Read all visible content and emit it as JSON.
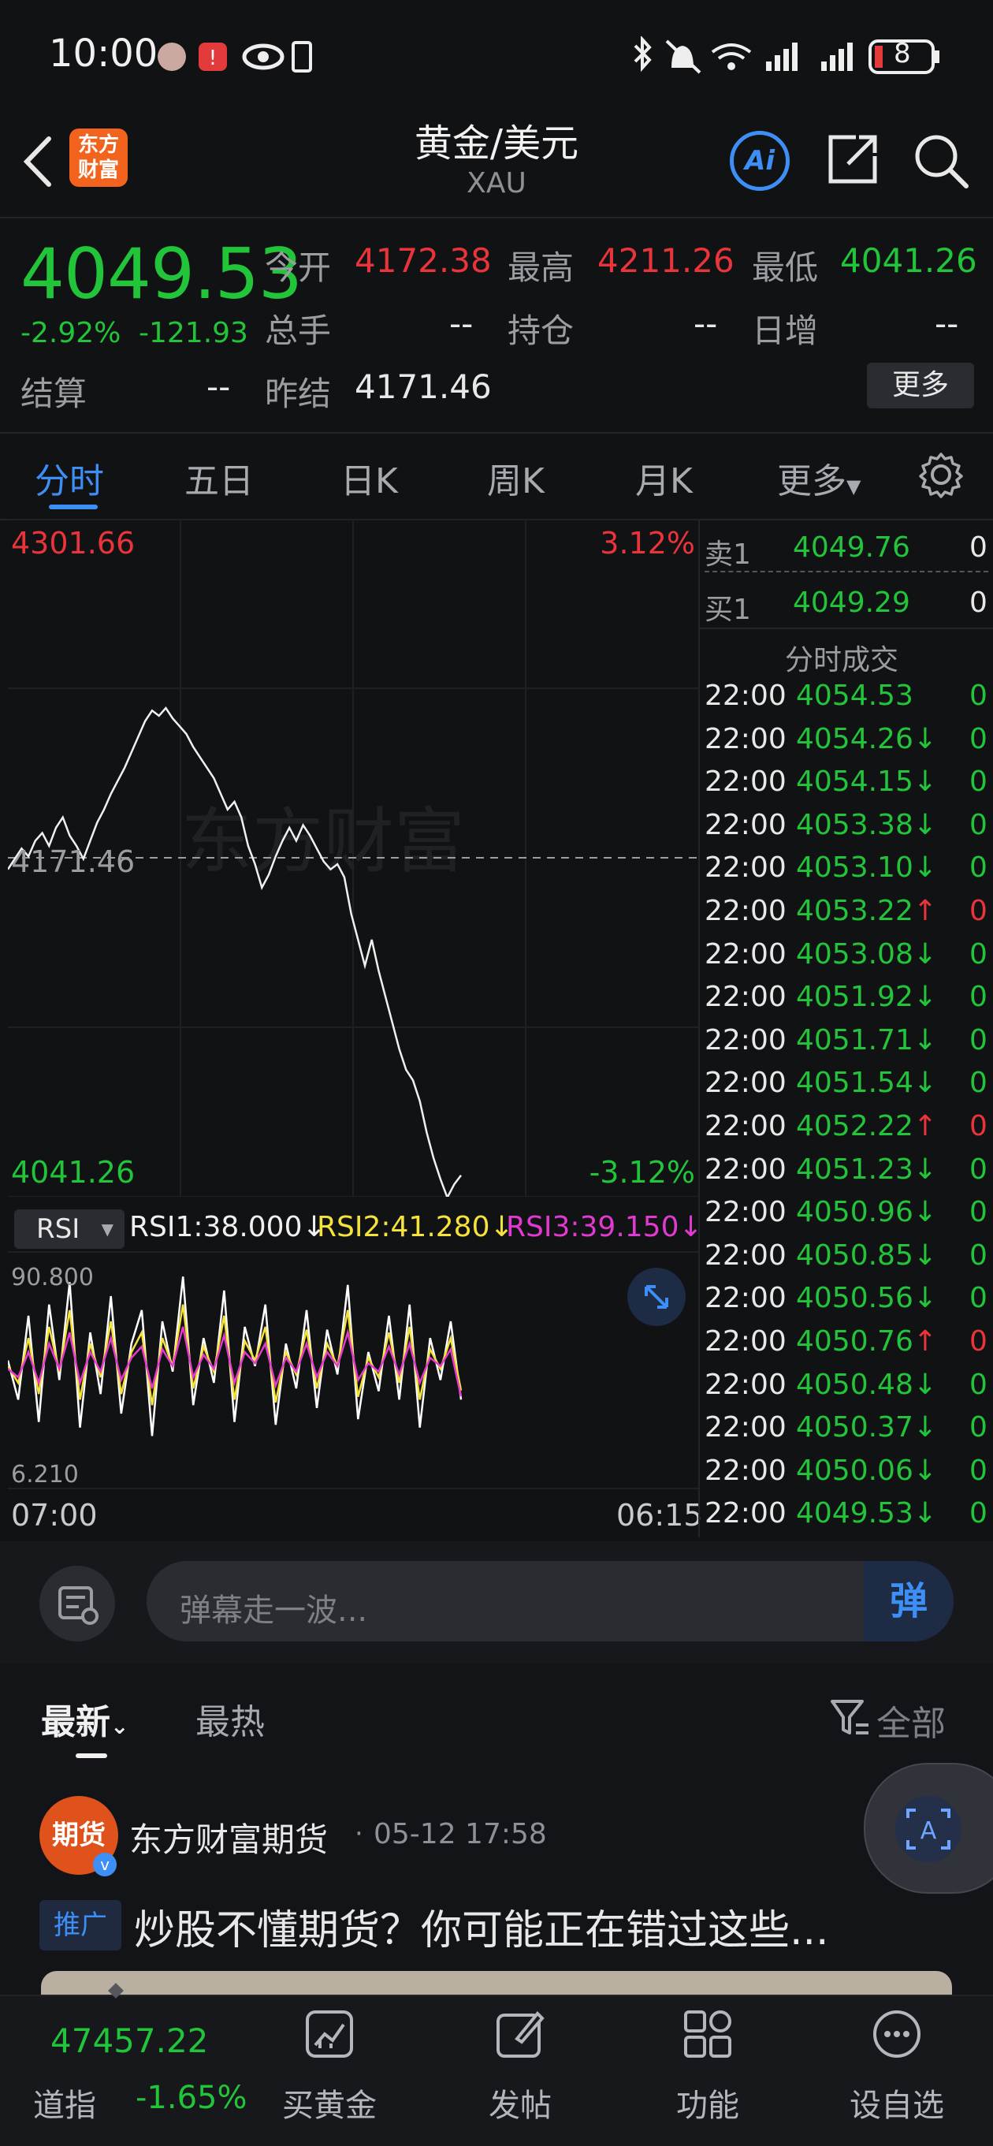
{
  "status": {
    "time": "10:00",
    "battery": "8"
  },
  "header": {
    "brand_line1": "东方",
    "brand_line2": "财富",
    "title": "黄金/美元",
    "subtitle": "XAU",
    "ai_label": "Ai"
  },
  "quote": {
    "price": "4049.53",
    "pct": "-2.92%",
    "chg": "-121.93",
    "open_label": "今开",
    "open": "4172.38",
    "high_label": "最高",
    "high": "4211.26",
    "low_label": "最低",
    "low": "4041.26",
    "vol_label": "总手",
    "vol": "--",
    "oi_label": "持仓",
    "oi": "--",
    "daily_label": "日增",
    "daily": "--",
    "settle_label": "结算",
    "settle": "--",
    "prev_label": "昨结",
    "prev": "4171.46",
    "more_label": "更多"
  },
  "tabs": [
    "分时",
    "五日",
    "日K",
    "周K",
    "月K",
    "更多"
  ],
  "chart_data": [
    {
      "type": "line",
      "y_top_label": "4301.66",
      "y_bottom_label": "4041.26",
      "pct_top_label": "3.12%",
      "pct_bottom_label": "-3.12%",
      "ref_label": "4171.46",
      "x_start_label": "07:00",
      "x_end_label": "06:15",
      "watermark": "东方财富",
      "ylim": [
        4041.26,
        4301.66
      ],
      "series": [
        {
          "values": [
            4167,
            4171,
            4175,
            4172,
            4178,
            4181,
            4176,
            4183,
            4187,
            4180,
            4176,
            4171,
            4178,
            4185,
            4190,
            4196,
            4201,
            4206,
            4212,
            4218,
            4224,
            4228,
            4226,
            4229,
            4225,
            4222,
            4219,
            4214,
            4210,
            4206,
            4202,
            4196,
            4190,
            4193,
            4187,
            4176,
            4169,
            4160,
            4165,
            4172,
            4178,
            4183,
            4178,
            4184,
            4180,
            4175,
            4170,
            4167,
            4169,
            4164,
            4150,
            4140,
            4130,
            4140,
            4128,
            4118,
            4108,
            4098,
            4090,
            4086,
            4078,
            4066,
            4056,
            4048,
            4041,
            4046,
            4049.53
          ]
        }
      ]
    },
    {
      "type": "line",
      "selector": "RSI",
      "title_rsi1": "RSI1:38.000",
      "title_rsi2": "RSI2:41.280",
      "title_rsi3": "RSI3:39.150",
      "y_top_label": "90.800",
      "y_bottom_label": "6.210",
      "ylim": [
        6.21,
        90.8
      ],
      "series": [
        {
          "name": "RSI1",
          "color": "#ffffff",
          "values": [
            52,
            38,
            68,
            30,
            72,
            45,
            80,
            28,
            62,
            40,
            75,
            33,
            58,
            70,
            25,
            66,
            48,
            82,
            36,
            60,
            44,
            77,
            30,
            64,
            50,
            72,
            29,
            58,
            42,
            70,
            35,
            63,
            47,
            79,
            31,
            55,
            41,
            68,
            38,
            72,
            28,
            60,
            45,
            66,
            38
          ]
        },
        {
          "name": "RSI2",
          "color": "#f5e23a",
          "values": [
            50,
            44,
            60,
            40,
            64,
            48,
            70,
            38,
            58,
            46,
            66,
            40,
            55,
            62,
            36,
            60,
            50,
            72,
            42,
            57,
            48,
            68,
            38,
            59,
            52,
            64,
            37,
            55,
            47,
            63,
            42,
            58,
            50,
            70,
            39,
            53,
            46,
            62,
            44,
            64,
            38,
            56,
            49,
            60,
            41.28
          ]
        },
        {
          "name": "RSI3",
          "color": "#e23ad0",
          "values": [
            49,
            46,
            55,
            44,
            58,
            49,
            62,
            44,
            55,
            48,
            60,
            45,
            53,
            57,
            42,
            56,
            50,
            64,
            46,
            54,
            49,
            61,
            44,
            55,
            51,
            58,
            43,
            53,
            48,
            58,
            46,
            55,
            50,
            62,
            45,
            51,
            48,
            57,
            47,
            58,
            44,
            53,
            50,
            56,
            39.15
          ]
        }
      ]
    }
  ],
  "orderbook": {
    "ask_label": "卖1",
    "ask": "4049.76",
    "ask_vol": "0",
    "bid_label": "买1",
    "bid": "4049.29",
    "bid_vol": "0",
    "trades_title": "分时成交"
  },
  "trades": [
    {
      "t": "22:00",
      "p": "4054.53",
      "a": "",
      "v": "0",
      "c": "green"
    },
    {
      "t": "22:00",
      "p": "4054.26",
      "a": "↓",
      "v": "0",
      "c": "green"
    },
    {
      "t": "22:00",
      "p": "4054.15",
      "a": "↓",
      "v": "0",
      "c": "green"
    },
    {
      "t": "22:00",
      "p": "4053.38",
      "a": "↓",
      "v": "0",
      "c": "green"
    },
    {
      "t": "22:00",
      "p": "4053.10",
      "a": "↓",
      "v": "0",
      "c": "green"
    },
    {
      "t": "22:00",
      "p": "4053.22",
      "a": "↑",
      "v": "0",
      "c": "green"
    },
    {
      "t": "22:00",
      "p": "4053.08",
      "a": "↓",
      "v": "0",
      "c": "green"
    },
    {
      "t": "22:00",
      "p": "4051.92",
      "a": "↓",
      "v": "0",
      "c": "green"
    },
    {
      "t": "22:00",
      "p": "4051.71",
      "a": "↓",
      "v": "0",
      "c": "green"
    },
    {
      "t": "22:00",
      "p": "4051.54",
      "a": "↓",
      "v": "0",
      "c": "green"
    },
    {
      "t": "22:00",
      "p": "4052.22",
      "a": "↑",
      "v": "0",
      "c": "green"
    },
    {
      "t": "22:00",
      "p": "4051.23",
      "a": "↓",
      "v": "0",
      "c": "green"
    },
    {
      "t": "22:00",
      "p": "4050.96",
      "a": "↓",
      "v": "0",
      "c": "green"
    },
    {
      "t": "22:00",
      "p": "4050.85",
      "a": "↓",
      "v": "0",
      "c": "green"
    },
    {
      "t": "22:00",
      "p": "4050.56",
      "a": "↓",
      "v": "0",
      "c": "green"
    },
    {
      "t": "22:00",
      "p": "4050.76",
      "a": "↑",
      "v": "0",
      "c": "green"
    },
    {
      "t": "22:00",
      "p": "4050.48",
      "a": "↓",
      "v": "0",
      "c": "green"
    },
    {
      "t": "22:00",
      "p": "4050.37",
      "a": "↓",
      "v": "0",
      "c": "green"
    },
    {
      "t": "22:00",
      "p": "4050.06",
      "a": "↓",
      "v": "0",
      "c": "green"
    },
    {
      "t": "22:00",
      "p": "4049.53",
      "a": "↓",
      "v": "0",
      "c": "green"
    }
  ],
  "comment": {
    "placeholder": "弹幕走一波...",
    "danmu_label": "弹"
  },
  "news": {
    "tab_latest": "最新",
    "tab_hot": "最热",
    "filter_label": "全部",
    "author": "东方财富期货",
    "avatar_text": "期货",
    "time": "05-12 17:58",
    "badge": "推广",
    "headline": "炒股不懂期货？你可能正在错过这些..."
  },
  "bottom_nav": {
    "index_value": "47457.22",
    "index_label": "道指",
    "index_pct": "-1.65%",
    "buy_gold": "买黄金",
    "post": "发帖",
    "functions": "功能",
    "watchlist": "设自选"
  }
}
